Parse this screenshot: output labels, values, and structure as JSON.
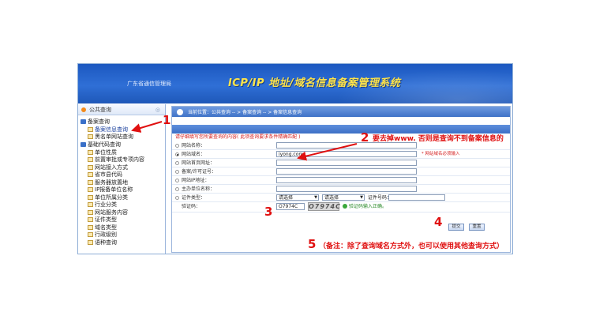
{
  "banner": {
    "org": "广东省通信管理局",
    "title": "ICP/IP 地址/域名信息备案管理系统"
  },
  "sidebar": {
    "header": "公共查询",
    "groups": [
      {
        "label": "备案查询",
        "items": [
          "备案信息查询",
          "黑名单网站查询"
        ]
      },
      {
        "label": "基础代码查询",
        "items": [
          "单位性质",
          "前置审批或专项内容",
          "网站接入方式",
          "省市县代码",
          "服务器放置地",
          "IP报备单位名称",
          "单位所属分类",
          "行业分类",
          "网站服务内容",
          "证件类型",
          "域名类型",
          "行政级别",
          "语种查询"
        ]
      }
    ]
  },
  "breadcrumb": "当前位置：公共查询 -- > 备案查询 -- > 备案信息查询",
  "hint": "请仔细填写您所要查询的内容( 此项查询要求条件精确匹配 )",
  "form": {
    "rows": [
      {
        "label": "网站名称：",
        "value": "",
        "checked": false
      },
      {
        "label": "网站域名：",
        "value": "iyong.com",
        "checked": true,
        "note": "* 网站域名必须输入"
      },
      {
        "label": "网站首页网址：",
        "value": "",
        "checked": false
      },
      {
        "label": "备案/许可证号：",
        "value": "",
        "checked": false
      },
      {
        "label": "网站IP地址：",
        "value": "",
        "checked": false
      },
      {
        "label": "主办单位名称：",
        "value": "",
        "checked": false
      }
    ],
    "cert_label": "证件类型：",
    "select1": "请选择",
    "select2": "请选择",
    "cert_no_label": "证件号码：",
    "captcha_label": "验证码：",
    "captcha_value": "O7974C",
    "captcha_image": "O7974C",
    "captcha_ok": "验证码输入正确。",
    "submit": "提交",
    "reset": "重置"
  },
  "annotations": {
    "n1": "1",
    "n2": "2",
    "n2_text": "要去掉www. 否则是查询不到备案信息的",
    "n3": "3",
    "n4": "4",
    "n5": "5",
    "n5_text": "（备注：除了查询域名方式外，也可以使用其他查询方式）"
  },
  "colors": {
    "banner": "#2f6fd6",
    "title": "#ffe44a",
    "annotation": "#e01010"
  }
}
